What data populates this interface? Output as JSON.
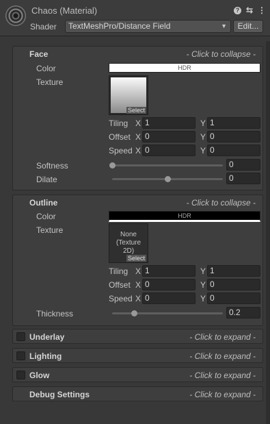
{
  "header": {
    "title": "Chaos (Material)",
    "help_icon": "?",
    "settings_icon": "⇆",
    "more_icon": "⋮",
    "shader_label": "Shader",
    "shader_value": "TextMeshPro/Distance Field",
    "edit_label": "Edit..."
  },
  "face": {
    "title": "Face",
    "hint": "- Click to collapse -",
    "color_label": "Color",
    "color_swatch": "HDR",
    "color_hex": "#ffffff",
    "texture_label": "Texture",
    "texture_select": "Select",
    "tiling_label": "Tiling",
    "offset_label": "Offset",
    "speed_label": "Speed",
    "axis_x": "X",
    "axis_y": "Y",
    "tiling_x": "1",
    "tiling_y": "1",
    "offset_x": "0",
    "offset_y": "0",
    "speed_x": "0",
    "speed_y": "0",
    "softness_label": "Softness",
    "softness_value": "0",
    "softness_level": 0,
    "dilate_label": "Dilate",
    "dilate_value": "0",
    "dilate_level": 0.5
  },
  "outline": {
    "title": "Outline",
    "hint": "- Click to collapse -",
    "color_label": "Color",
    "color_swatch": "HDR",
    "color_hex": "#000000",
    "texture_label": "Texture",
    "texture_none_1": "None",
    "texture_none_2": "(Texture",
    "texture_none_3": "2D)",
    "texture_select": "Select",
    "tiling_label": "Tiling",
    "offset_label": "Offset",
    "speed_label": "Speed",
    "axis_x": "X",
    "axis_y": "Y",
    "tiling_x": "1",
    "tiling_y": "1",
    "offset_x": "0",
    "offset_y": "0",
    "speed_x": "0",
    "speed_y": "0",
    "thickness_label": "Thickness",
    "thickness_value": "0.2",
    "thickness_level": 0.2
  },
  "sections": [
    {
      "title": "Underlay",
      "hint": "- Click to expand -"
    },
    {
      "title": "Lighting",
      "hint": "- Click to expand -"
    },
    {
      "title": "Glow",
      "hint": "- Click to expand -"
    },
    {
      "title": "Debug Settings",
      "hint": "- Click to expand -"
    }
  ]
}
